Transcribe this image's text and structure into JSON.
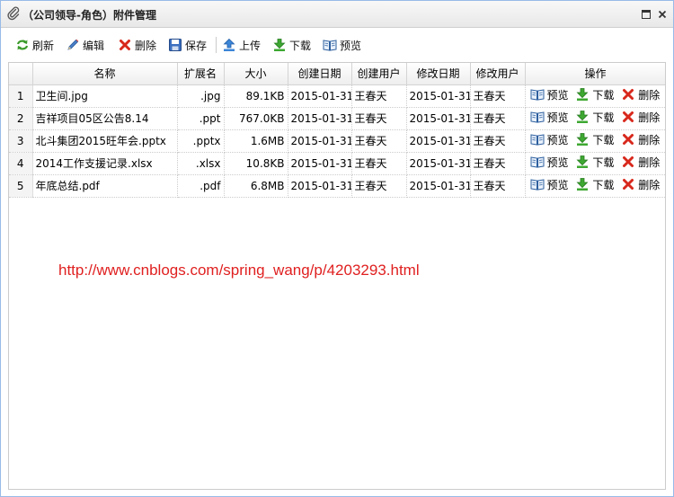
{
  "window": {
    "title": "（公司领导-角色）附件管理"
  },
  "toolbar": {
    "refresh": "刷新",
    "edit": "编辑",
    "delete": "删除",
    "save": "保存",
    "upload": "上传",
    "download": "下载",
    "preview": "预览"
  },
  "table": {
    "headers": [
      "名称",
      "扩展名",
      "大小",
      "创建日期",
      "创建用户",
      "修改日期",
      "修改用户",
      "操作"
    ],
    "ops": {
      "preview": "预览",
      "download": "下载",
      "delete": "删除"
    },
    "rows": [
      {
        "num": "1",
        "name": "卫生间.jpg",
        "ext": ".jpg",
        "size": "89.1KB",
        "created": "2015-01-31",
        "creator": "王春天",
        "modified": "2015-01-31",
        "modifier": "王春天"
      },
      {
        "num": "2",
        "name": "吉祥项目05区公告8.14",
        "ext": ".ppt",
        "size": "767.0KB",
        "created": "2015-01-31",
        "creator": "王春天",
        "modified": "2015-01-31",
        "modifier": "王春天"
      },
      {
        "num": "3",
        "name": "北斗集团2015旺年会.pptx",
        "ext": ".pptx",
        "size": "1.6MB",
        "created": "2015-01-31",
        "creator": "王春天",
        "modified": "2015-01-31",
        "modifier": "王春天"
      },
      {
        "num": "4",
        "name": "2014工作支援记录.xlsx",
        "ext": ".xlsx",
        "size": "10.8KB",
        "created": "2015-01-31",
        "creator": "王春天",
        "modified": "2015-01-31",
        "modifier": "王春天"
      },
      {
        "num": "5",
        "name": "年底总结.pdf",
        "ext": ".pdf",
        "size": "6.8MB",
        "created": "2015-01-31",
        "creator": "王春天",
        "modified": "2015-01-31",
        "modifier": "王春天"
      }
    ]
  },
  "watermark": "http://www.cnblogs.com/spring_wang/p/4203293.html",
  "colors": {
    "watermark": "#e02020",
    "border": "#99bbe8"
  }
}
